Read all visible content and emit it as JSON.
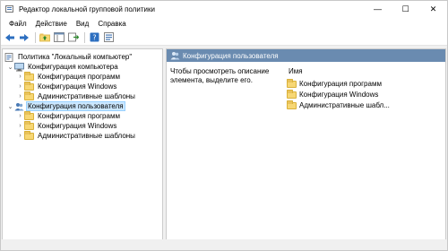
{
  "window": {
    "title": "Редактор локальной групповой политики",
    "controls": {
      "minimize": "—",
      "maximize": "☐",
      "close": "✕"
    }
  },
  "menu": [
    "Файл",
    "Действие",
    "Вид",
    "Справка"
  ],
  "toolbar": {
    "buttons": [
      "back-arrow-icon",
      "forward-arrow-icon",
      "up-folder-icon",
      "show-hide-tree-icon",
      "export-list-icon",
      "help-icon",
      "properties-icon"
    ]
  },
  "tree": {
    "root": "Политика \"Локальный компьютер\"",
    "computer_config": {
      "label": "Конфигурация компьютера",
      "children": [
        "Конфигурация программ",
        "Конфигурация Windows",
        "Административные шаблоны"
      ]
    },
    "user_config": {
      "label": "Конфигурация пользователя",
      "children": [
        "Конфигурация программ",
        "Конфигурация Windows",
        "Административные шаблоны"
      ]
    }
  },
  "right": {
    "header": "Конфигурация пользователя",
    "description": "Чтобы просмотреть описание элемента, выделите его.",
    "column_name": "Имя",
    "items": [
      "Конфигурация программ",
      "Конфигурация Windows",
      "Административные шабл..."
    ]
  },
  "colors": {
    "header_band": "#6a8bb0",
    "selection": "#cce8ff",
    "folder": "#f7d774"
  }
}
